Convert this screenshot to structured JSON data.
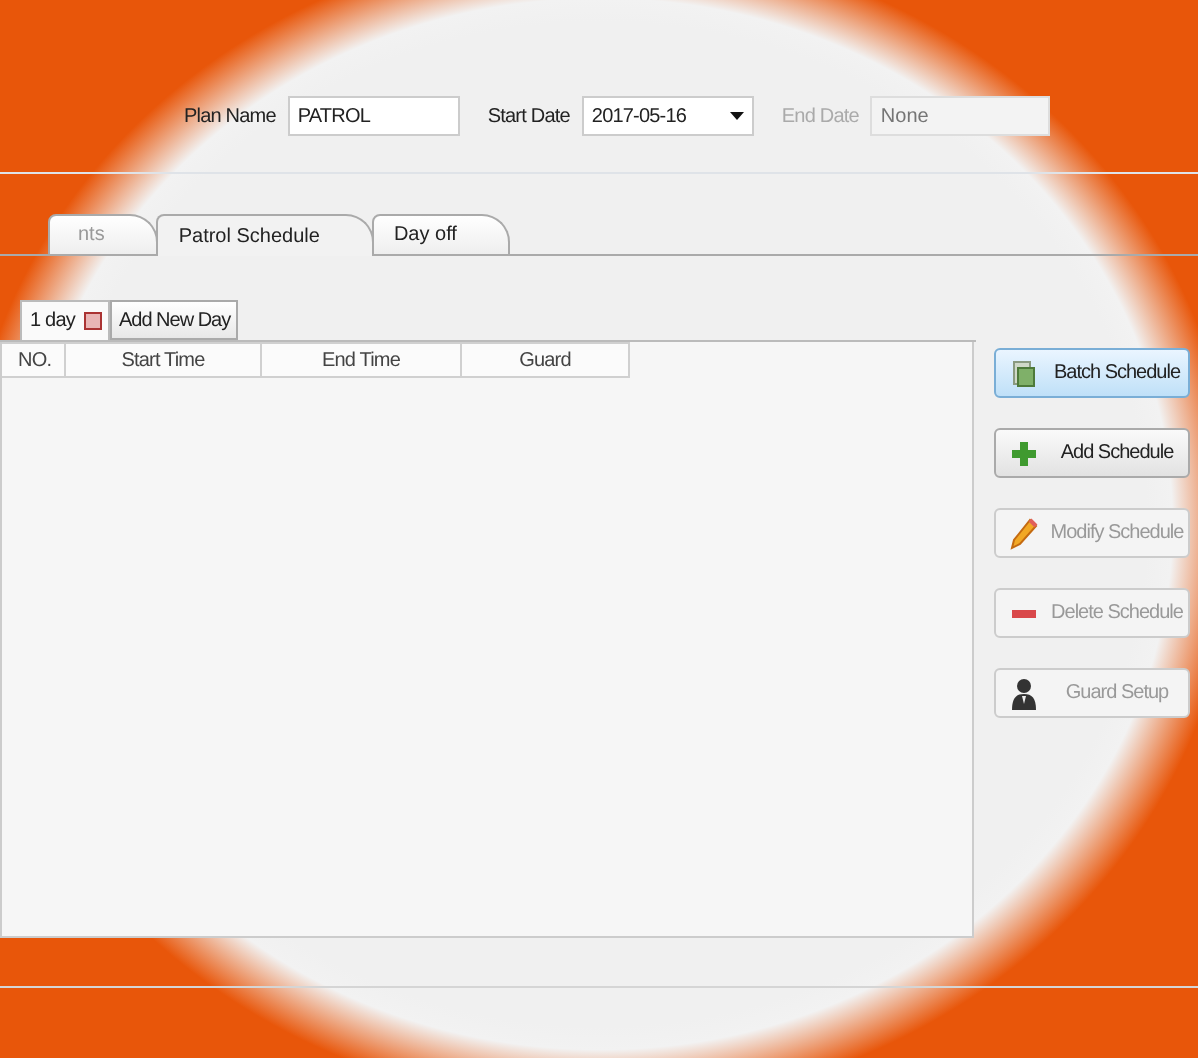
{
  "plan": {
    "name_label": "Plan Name",
    "name_value": "PATROL",
    "start_label": "Start Date",
    "start_value": "2017-05-16",
    "end_label": "End Date",
    "end_placeholder": "None",
    "end_disabled": true
  },
  "tabs": [
    {
      "label": "nts",
      "selected": false
    },
    {
      "label": "Patrol Schedule",
      "selected": true
    },
    {
      "label": "Day off",
      "selected": false
    }
  ],
  "day_tabs": [
    {
      "label": "1 day",
      "selected": true
    }
  ],
  "add_day": "Add New Day",
  "table": {
    "columns": [
      "NO.",
      "Start Time",
      "End Time",
      "Guard"
    ]
  },
  "buttons": [
    {
      "label": "Batch Schedule",
      "highlighted": true,
      "disabled": false
    },
    {
      "label": "Add Schedule",
      "highlighted": false,
      "disabled": false
    },
    {
      "label": "Modify Schedule",
      "highlighted": false,
      "disabled": true
    },
    {
      "label": "Delete Schedule",
      "highlighted": false,
      "disabled": true
    },
    {
      "label": "Guard Setup",
      "highlighted": false,
      "disabled": true
    }
  ]
}
